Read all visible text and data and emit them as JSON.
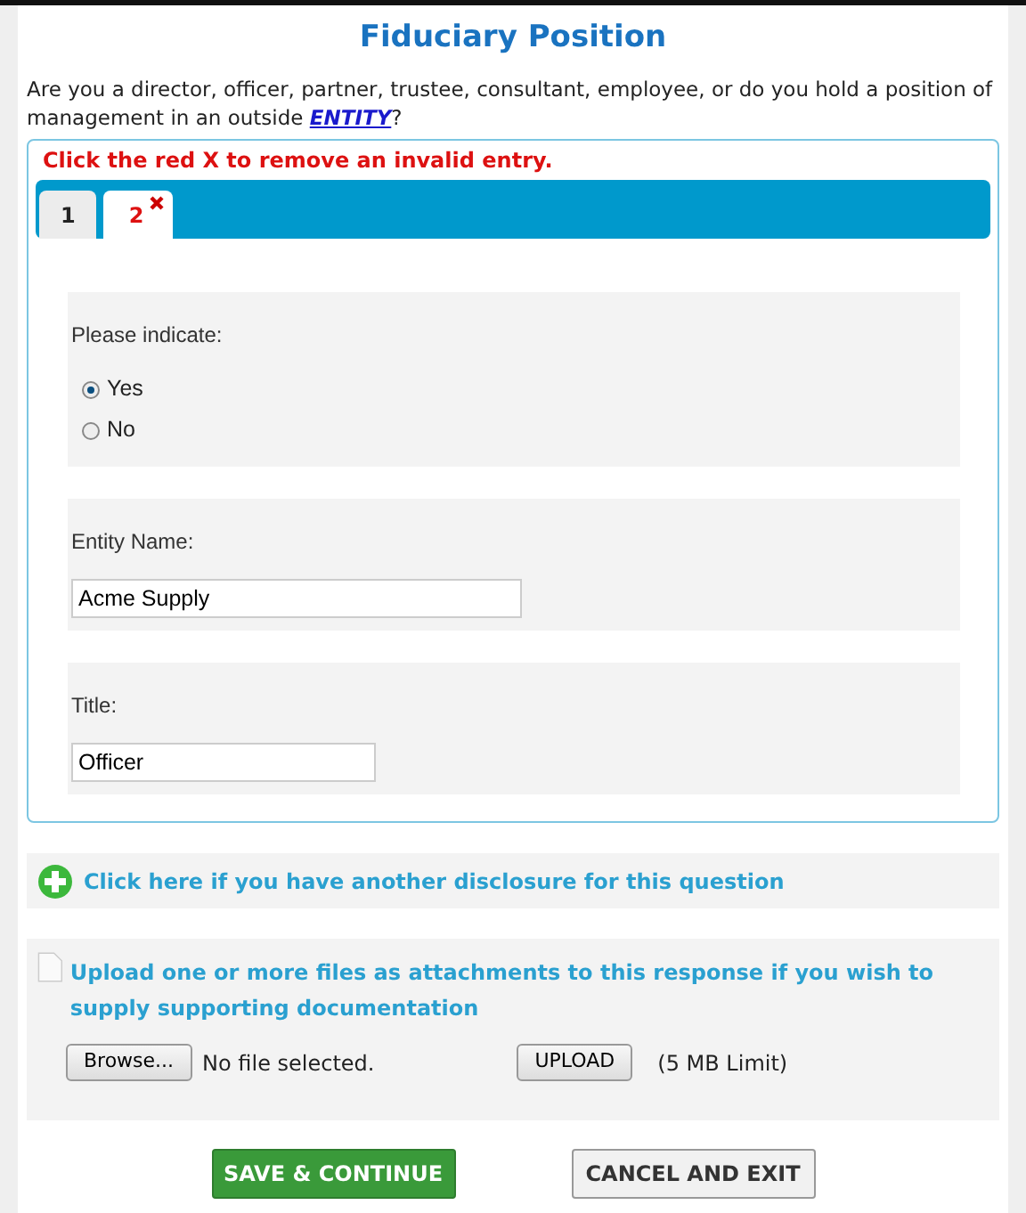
{
  "title": "Fiduciary Position",
  "question": {
    "text": "Are you a director, officer, partner, trustee, consultant, employee, or do you hold a position of management in an outside ",
    "link": "ENTITY",
    "after": "?"
  },
  "error_message": "Click the red X to remove an invalid entry.",
  "tabs": [
    {
      "label": "1",
      "selected": false,
      "removable": false
    },
    {
      "label": "2",
      "selected": true,
      "removable": true
    }
  ],
  "indicate": {
    "label": "Please indicate:",
    "options": [
      {
        "label": "Yes",
        "selected": true
      },
      {
        "label": "No",
        "selected": false
      }
    ]
  },
  "fields": [
    {
      "label": "Entity Name:",
      "value": "Acme Supply"
    },
    {
      "label": "Title:",
      "value": "Officer"
    }
  ],
  "add_link": "Click here if you have another disclosure for this question",
  "upload": {
    "text": "Upload one or more files as attachments to this response if you wish to supply supporting documentation",
    "browse": "Browse...",
    "file_status": "No file selected.",
    "upload_button": "UPLOAD",
    "limit": "(5 MB Limit)"
  },
  "buttons": [
    {
      "label": "SAVE & CONTINUE",
      "kind": "primary"
    },
    {
      "label": "CANCEL AND EXIT",
      "kind": "secondary"
    }
  ]
}
